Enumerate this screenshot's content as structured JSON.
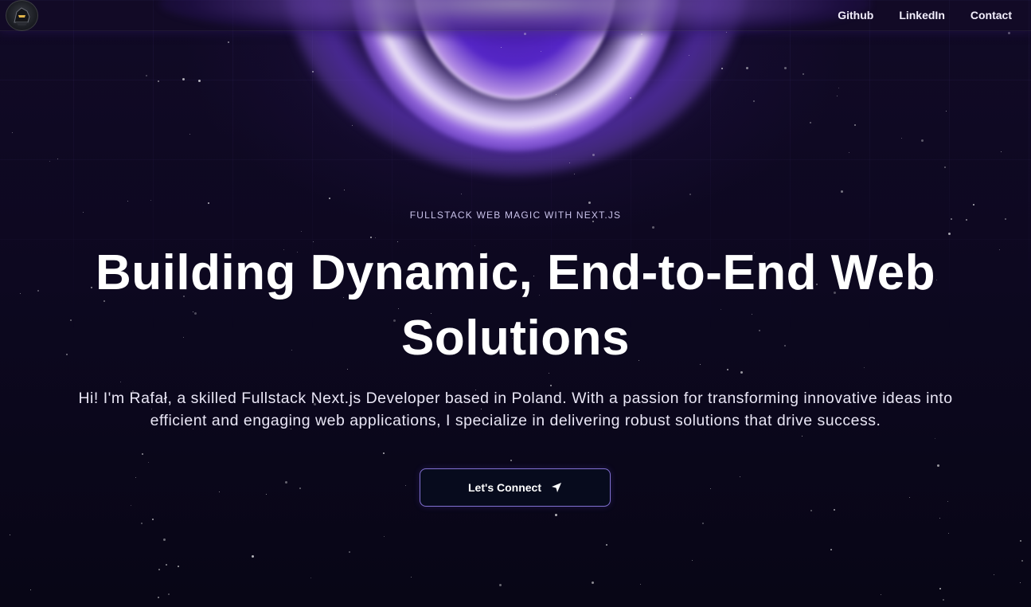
{
  "nav": {
    "logo_alt": "",
    "links": [
      {
        "label": "Github"
      },
      {
        "label": "LinkedIn"
      },
      {
        "label": "Contact"
      }
    ]
  },
  "hero": {
    "eyebrow": "FULLSTACK WEB MAGIC WITH NEXT.JS",
    "headline": "Building Dynamic, End-to-End Web Solutions",
    "intro": "Hi! I'm Rafał, a skilled Fullstack Next.js Developer based in Poland. With a passion for transforming innovative ideas into efficient and engaging web applications, I specialize in delivering robust solutions that drive success.",
    "cta_label": "Let's Connect",
    "cta_icon": "send-arrow-icon"
  },
  "colors": {
    "background": "#0b0718",
    "accent": "#8b5cf6",
    "button_border": "#9682f0",
    "button_bg": "#070b1d",
    "text": "#ffffff"
  }
}
